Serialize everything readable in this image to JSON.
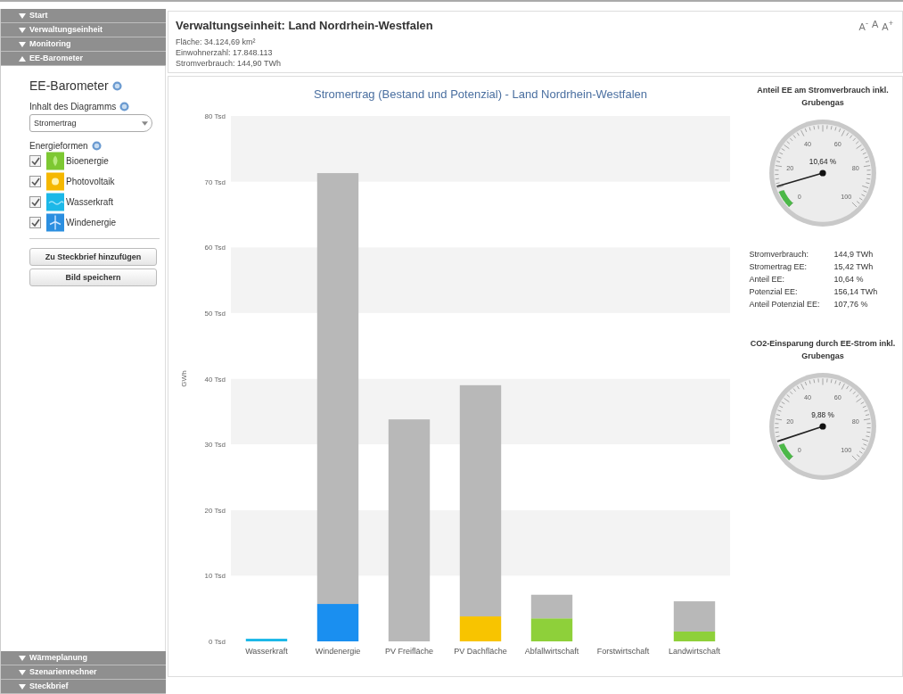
{
  "sidebar": {
    "sections_top": [
      {
        "label": "Start",
        "expanded": false
      },
      {
        "label": "Verwaltungseinheit",
        "expanded": false
      },
      {
        "label": "Monitoring",
        "expanded": false
      },
      {
        "label": "EE-Barometer",
        "expanded": true
      }
    ],
    "panel": {
      "title": "EE-Barometer",
      "content_label": "Inhalt des Diagramms",
      "content_select": "Stromertrag",
      "energy_label": "Energieformen",
      "energy_forms": [
        {
          "label": "Bioenergie",
          "checked": true,
          "color": "#7dc832",
          "kind": "leaf"
        },
        {
          "label": "Photovoltaik",
          "checked": true,
          "color": "#f5b800",
          "kind": "sun"
        },
        {
          "label": "Wasserkraft",
          "checked": true,
          "color": "#1cb8e8",
          "kind": "wave"
        },
        {
          "label": "Windenergie",
          "checked": true,
          "color": "#2b8fe0",
          "kind": "wind"
        }
      ],
      "buttons": [
        "Zu Steckbrief hinzufügen",
        "Bild speichern"
      ]
    },
    "sections_bottom": [
      {
        "label": "Wärmeplanung",
        "expanded": false
      },
      {
        "label": "Szenarienrechner",
        "expanded": false
      },
      {
        "label": "Steckbrief",
        "expanded": false
      }
    ]
  },
  "header": {
    "title": "Verwaltungseinheit: Land Nordrhein-Westfalen",
    "lines": [
      "Fläche: 34.124,69 km²",
      "Einwohnerzahl: 17.848.113",
      "Stromverbrauch: 144,90 TWh"
    ],
    "font_sizes": [
      "A$^{-}$",
      "A",
      "A$^{+}$"
    ]
  },
  "chart": {
    "chart_data": {
      "type": "bar",
      "title": "Stromertrag (Bestand und Potenzial) - Land Nordrhein-Westfalen",
      "ylabel": "GWh",
      "stacked": true,
      "categories": [
        "Wasserkraft",
        "Windenergie",
        "PV Freifläche",
        "PV Dachfläche",
        "Abfallwirtschaft",
        "Forstwirtschaft",
        "Landwirtschaft"
      ],
      "series": [
        {
          "color": "#1cb8e8",
          "values": [
            0.4,
            0,
            0,
            0,
            0,
            0,
            0
          ]
        },
        {
          "color": "#1a8ff0",
          "values": [
            0,
            5.7,
            0,
            0,
            0,
            0,
            0
          ]
        },
        {
          "color": "#f8c400",
          "values": [
            0,
            0,
            0,
            3.8,
            0,
            0,
            0
          ]
        },
        {
          "color": "#8ed03a",
          "values": [
            0,
            0,
            0,
            0,
            3.5,
            0,
            1.5
          ]
        },
        {
          "color": "#b8b8b8",
          "values": [
            0,
            65.6,
            33.8,
            35.2,
            3.6,
            0,
            4.6
          ]
        }
      ],
      "ylim": [
        0,
        80
      ],
      "yticks": [
        {
          "value": 0,
          "label": "0 Tsd"
        },
        {
          "value": 10,
          "label": "10 Tsd"
        },
        {
          "value": 20,
          "label": "20 Tsd"
        },
        {
          "value": 30,
          "label": "30 Tsd"
        },
        {
          "value": 40,
          "label": "40 Tsd"
        },
        {
          "value": 50,
          "label": "50 Tsd"
        },
        {
          "value": 60,
          "label": "60 Tsd"
        },
        {
          "value": 70,
          "label": "70 Tsd"
        },
        {
          "value": 80,
          "label": "80 Tsd"
        }
      ]
    }
  },
  "gauges": [
    {
      "title": "Anteil EE am Stromverbrauch inkl. Grubengas",
      "reading": "10,64 %",
      "level": 0.1064,
      "ticks": [
        "0",
        "20",
        "40",
        "60",
        "80",
        "100"
      ],
      "stats": [
        {
          "label": "Stromverbrauch:",
          "value": "144,9 TWh"
        },
        {
          "label": "Stromertrag EE:",
          "value": "15,42 TWh"
        },
        {
          "label": "Anteil EE:",
          "value": "10,64 %"
        },
        {
          "label": "Potenzial EE:",
          "value": "156,14 TWh"
        },
        {
          "label": "Anteil Potenzial EE:",
          "value": "107,76 %"
        }
      ]
    },
    {
      "title": "CO2-Einsparung durch EE-Strom inkl. Grubengas",
      "reading": "9,88 %",
      "level": 0.0988,
      "ticks": [
        "0",
        "20",
        "40",
        "60",
        "80",
        "100"
      ]
    }
  ]
}
